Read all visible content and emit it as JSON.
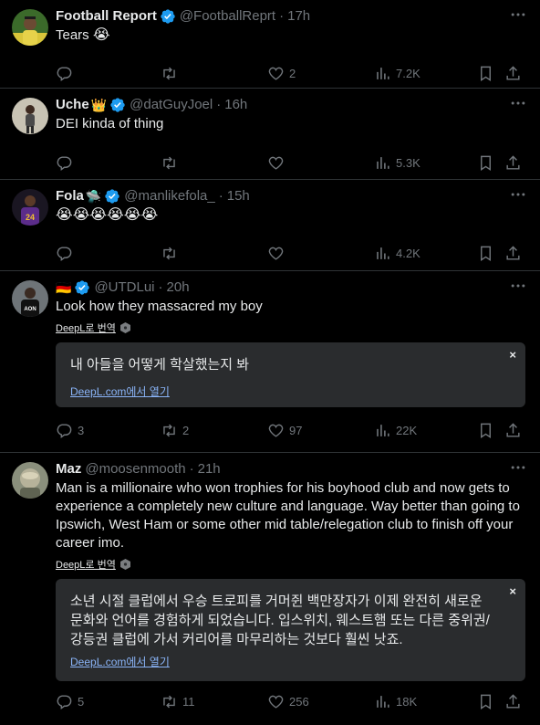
{
  "tweets": [
    {
      "name": "Football Report",
      "emoji": "",
      "verified": true,
      "handle": "@FootballReprt",
      "time": "17h",
      "text": "Tears",
      "text_emoji": "😭",
      "reply_count": "",
      "retweet_count": "",
      "like_count": "2",
      "view_count": "7.2K"
    },
    {
      "name": "Uche",
      "emoji": "👑",
      "verified": true,
      "handle": "@datGuyJoel",
      "time": "16h",
      "text": "DEI kinda of thing",
      "reply_count": "",
      "retweet_count": "",
      "like_count": "",
      "view_count": "5.3K"
    },
    {
      "name": "Fola",
      "emoji": "🛸",
      "verified": true,
      "handle": "@manlikefola_",
      "time": "15h",
      "text": "",
      "text_emoji": "😭😭😭😭😭😭",
      "reply_count": "",
      "retweet_count": "",
      "like_count": "",
      "view_count": "4.2K"
    },
    {
      "name": "",
      "emoji": "🇩🇪",
      "verified": true,
      "handle": "@UTDLui",
      "time": "20h",
      "text": "Look how they massacred my boy",
      "deepl_label": "DeepL로 번역",
      "translation": "내 아들을 어떻게 학살했는지 봐",
      "deepl_open": "DeepL.com에서 열기",
      "close_glyph": "×",
      "reply_count": "3",
      "retweet_count": "2",
      "like_count": "97",
      "view_count": "22K"
    },
    {
      "name": "Maz",
      "emoji": "",
      "verified": false,
      "handle": "@moosenmooth",
      "time": "21h",
      "text": "Man is a millionaire who won trophies for his boyhood club and now gets to experience a completely new culture and language. Way better than going to Ipswich, West Ham or some other mid table/relegation club to finish off your career imo.",
      "deepl_label": "DeepL로 번역",
      "translation": "소년 시절 클럽에서 우승 트로피를 거머쥔 백만장자가 이제 완전히 새로운 문화와 언어를 경험하게 되었습니다. 입스위치, 웨스트햄 또는 다른 중위권/강등권 클럽에 가서 커리어를 마무리하는 것보다 훨씬 낫죠.",
      "deepl_open": "DeepL.com에서 열기",
      "close_glyph": "×",
      "reply_count": "5",
      "retweet_count": "11",
      "like_count": "256",
      "view_count": "18K"
    }
  ],
  "separator": "·",
  "colors": {
    "background": "#000000",
    "primary_text": "#e7e9ea",
    "secondary_text": "#71767b",
    "divider": "#2f3336",
    "verified_blue": "#1d9bf0",
    "translation_box": "#2a2c2e",
    "link_blue": "#8ab4f8"
  },
  "icons": [
    "more-icon",
    "verified-icon",
    "reply-icon",
    "retweet-icon",
    "like-icon",
    "views-icon",
    "bookmark-icon",
    "share-icon",
    "deepl-icon",
    "close-icon"
  ]
}
